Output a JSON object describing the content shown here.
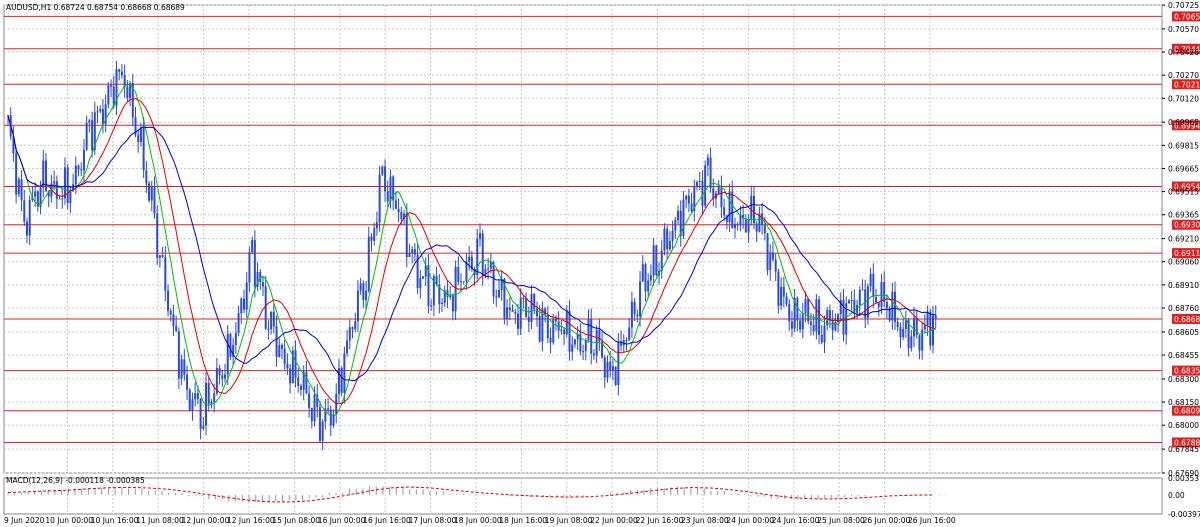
{
  "header": {
    "symbol_line": "AUDUSD,H1  0.68724 0.68754 0.68668 0.68689",
    "indicator_line": "MACD(12,26,9) -0.000118 -0.000385"
  },
  "colors": {
    "bull": "#2a4bd7",
    "hline": "#e02020",
    "ma_fast": "#00c000",
    "ma_mid": "#e00000",
    "ma_slow": "#0000e0",
    "grid": "#c8c8c8"
  },
  "chart_data": [
    {
      "type": "candlestick",
      "symbol": "AUDUSD",
      "timeframe": "H1",
      "ylim": [
        0.6769,
        0.70725
      ],
      "y_ticks": [
        "0.70725",
        "0.70570",
        "0.70420",
        "0.70270",
        "0.70120",
        "0.69965",
        "0.69815",
        "0.69665",
        "0.69515",
        "0.69365",
        "0.69210",
        "0.69060",
        "0.68910",
        "0.68760",
        "0.68605",
        "0.68455",
        "0.68300",
        "0.68150",
        "0.68000",
        "0.67845",
        "0.67690"
      ],
      "x_labels": [
        "9 Jun 2020",
        "10 Jun 00:00",
        "10 Jun 16:00",
        "11 Jun 08:00",
        "12 Jun 00:00",
        "12 Jun 16:00",
        "15 Jun 08:00",
        "16 Jun 00:00",
        "16 Jun 16:00",
        "17 Jun 08:00",
        "18 Jun 00:00",
        "18 Jun 16:00",
        "19 Jun 08:00",
        "22 Jun 00:00",
        "22 Jun 16:00",
        "23 Jun 08:00",
        "24 Jun 00:00",
        "24 Jun 16:00",
        "25 Jun 08:00",
        "26 Jun 00:00",
        "26 Jun 16:00"
      ],
      "horizontal_levels": [
        "0.70651",
        "0.70441",
        "0.70211",
        "0.69945",
        "0.69548",
        "0.69300",
        "0.69116",
        "0.68689",
        "0.68354",
        "0.68094",
        "0.67888"
      ],
      "series": [
        {
          "name": "close",
          "values": [
            0.6995,
            0.693,
            0.696,
            0.695,
            0.6955,
            0.699,
            0.701,
            0.703,
            0.699,
            0.693,
            0.687,
            0.682,
            0.681,
            0.683,
            0.686,
            0.691,
            0.687,
            0.684,
            0.683,
            0.68,
            0.681,
            0.686,
            0.69,
            0.696,
            0.694,
            0.69,
            0.689,
            0.688,
            0.69,
            0.691,
            0.689,
            0.687,
            0.688,
            0.686,
            0.6865,
            0.685,
            0.686,
            0.683,
            0.686,
            0.689,
            0.691,
            0.693,
            0.695,
            0.696,
            0.694,
            0.693,
            0.694,
            0.69,
            0.687,
            0.687,
            0.6865,
            0.687,
            0.688,
            0.6885,
            0.688,
            0.686,
            0.686,
            0.6869
          ]
        }
      ]
    },
    {
      "type": "bar",
      "name": "MACD(12,26,9)",
      "ylim": [
        -0.003979,
        0.003537
      ],
      "y_ticks": [
        "0.003537",
        "0.00",
        "-0.003979"
      ],
      "values": [
        0.0005,
        0.0008,
        0.0012,
        0.0015,
        0.0016,
        0.0017,
        0.0015,
        0.001,
        0.0005,
        -0.0003,
        -0.001,
        -0.0015,
        -0.0017,
        -0.0015,
        -0.0012,
        -0.0006,
        0.0005,
        0.0015,
        0.002,
        0.0018,
        0.0013,
        0.0008,
        0.0003,
        0.0002,
        -0.0001,
        -0.0003,
        -0.0005,
        -0.0006,
        -0.0004,
        0.0,
        0.0006,
        0.0012,
        0.0016,
        0.0018,
        0.0015,
        0.0009,
        0.0002,
        -0.0004,
        -0.0009,
        -0.001,
        -0.0009,
        -0.0006,
        -0.0003,
        0.0,
        0.0001,
        0.0,
        -0.0001
      ]
    }
  ]
}
